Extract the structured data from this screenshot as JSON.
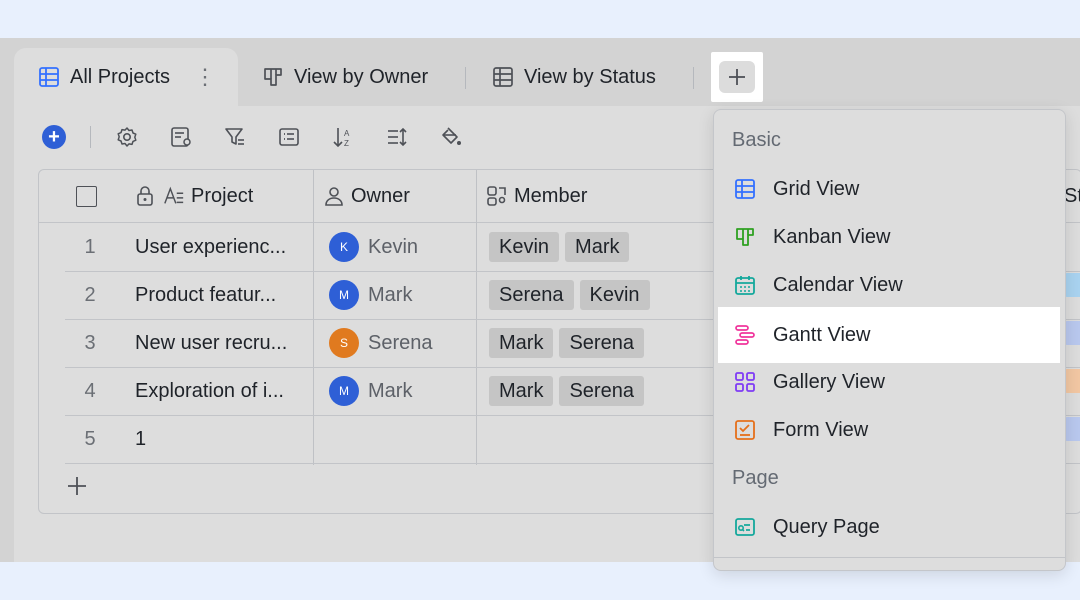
{
  "tabs": [
    {
      "label": "All Projects",
      "icon": "grid-view-icon",
      "active": true
    },
    {
      "label": "View by Owner",
      "icon": "kanban-view-icon"
    },
    {
      "label": "View by Status",
      "icon": "grid-view-icon"
    }
  ],
  "table": {
    "columns": [
      {
        "label": "Project",
        "icon": "text-field-icon"
      },
      {
        "label": "Owner",
        "icon": "person-icon"
      },
      {
        "label": "Member",
        "icon": "group-icon"
      },
      {
        "label": "St",
        "icon": ""
      }
    ],
    "rows": [
      {
        "num": "1",
        "project": "User experienc...",
        "owner": "Kevin",
        "owner_initial": "K",
        "owner_color": "#2e5fd6",
        "members": [
          "Kevin",
          "Mark"
        ],
        "status_color": "#a9d3f0"
      },
      {
        "num": "2",
        "project": "Product featur...",
        "owner": "Mark",
        "owner_initial": "M",
        "owner_color": "#2e5fd6",
        "members": [
          "Serena",
          "Kevin"
        ],
        "status_color": "#b9c8ee"
      },
      {
        "num": "3",
        "project": "New user recru...",
        "owner": "Serena",
        "owner_initial": "S",
        "owner_color": "#e07a1f",
        "members": [
          "Mark",
          "Serena"
        ],
        "status_color": "#f2c7a3"
      },
      {
        "num": "4",
        "project": "Exploration of i...",
        "owner": "Mark",
        "owner_initial": "M",
        "owner_color": "#2e5fd6",
        "members": [
          "Mark",
          "Serena"
        ],
        "status_color": "#b9c8ee"
      },
      {
        "num": "5",
        "project": "1",
        "owner": "",
        "members": []
      }
    ]
  },
  "menu": {
    "section_basic": "Basic",
    "items": [
      {
        "label": "Grid View",
        "icon": "grid-view-icon",
        "color": "#3370ff"
      },
      {
        "label": "Kanban View",
        "icon": "kanban-view-icon",
        "color": "#2ea121"
      },
      {
        "label": "Calendar View",
        "icon": "calendar-view-icon",
        "color": "#14a89c"
      },
      {
        "label": "Gantt View",
        "icon": "gantt-view-icon",
        "color": "#f0359c",
        "highlighted": true
      },
      {
        "label": "Gallery View",
        "icon": "gallery-view-icon",
        "color": "#7f3bf5"
      },
      {
        "label": "Form View",
        "icon": "form-view-icon",
        "color": "#e5701b"
      }
    ],
    "section_page": "Page",
    "page_items": [
      {
        "label": "Query Page",
        "icon": "query-page-icon",
        "color": "#14a89c"
      }
    ]
  }
}
